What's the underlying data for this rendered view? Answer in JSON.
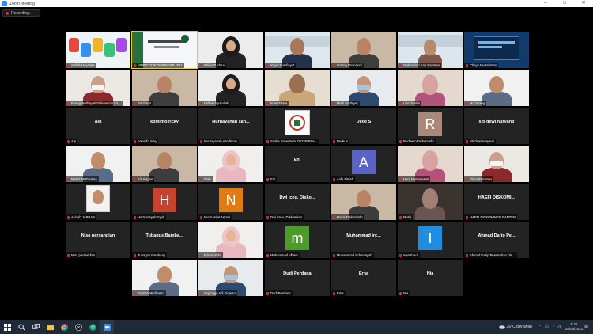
{
  "window": {
    "title": "Zoom Meeting",
    "controls": [
      "–",
      "□",
      "✕"
    ]
  },
  "recording": {
    "label": "Recording..."
  },
  "participants": [
    {
      "name": "Sofiah Hayatipa",
      "kind": "video",
      "scene": "letters"
    },
    {
      "name": "VIDEO DISKOMINFOSP 2021",
      "kind": "video",
      "scene": "banner",
      "active": true
    },
    {
      "name": "Erlina Zuchea",
      "kind": "video",
      "scene": "hijab-dark"
    },
    {
      "name": "Yayat Rusdiayat",
      "kind": "video",
      "scene": "man-building"
    },
    {
      "name": "Imtong Rusnandi",
      "kind": "video",
      "scene": "man-room"
    },
    {
      "name": "Diskominfo Kab.Bayaraa",
      "kind": "video",
      "scene": "building-lady"
    },
    {
      "name": "Cheyz Nurrahman",
      "kind": "video",
      "scene": "screen"
    },
    {
      "name": "Eneng Nurhayati Diskominfo Ka...",
      "kind": "video",
      "scene": "mask-red"
    },
    {
      "name": "Rachmat",
      "kind": "video",
      "scene": "man-room"
    },
    {
      "name": "Didi Hidayatullah",
      "kind": "video",
      "scene": "hijab-dark"
    },
    {
      "name": "Irvan Fitara",
      "kind": "video",
      "scene": "man-office"
    },
    {
      "name": "Marli Subhiyat",
      "kind": "video",
      "scene": "mask-blue"
    },
    {
      "name": "Lilis Danilis",
      "kind": "video",
      "scene": "lady-light"
    },
    {
      "name": "M Cacang",
      "kind": "video",
      "scene": "man-white"
    },
    {
      "name": "Aip",
      "kind": "name",
      "display": "Aip"
    },
    {
      "name": "kominfo ricky",
      "kind": "name",
      "display": "kominfo ricky"
    },
    {
      "name": "Nurhayanah sandiman",
      "kind": "name",
      "display": "Nurhayanah san..."
    },
    {
      "name": "Suska Sekertariat DKISP Prov...",
      "kind": "video",
      "scene": "logo"
    },
    {
      "name": "Dede S",
      "kind": "name",
      "display": "Dede S"
    },
    {
      "name": "Rudianto Diskominfo",
      "kind": "initial",
      "display": "R",
      "color": "#a9887a"
    },
    {
      "name": "siti dewi nuryanti",
      "kind": "name",
      "display": "siti dewi nuryanti"
    },
    {
      "name": "NANA NUGYANA",
      "kind": "video",
      "scene": "man-white"
    },
    {
      "name": "Ale Bagas",
      "kind": "video",
      "scene": "man-room"
    },
    {
      "name": "Diah",
      "kind": "video",
      "scene": "hijab-pink"
    },
    {
      "name": "Eni",
      "kind": "name",
      "display": "Eni"
    },
    {
      "name": "Aida Fitriah",
      "kind": "initial",
      "display": "A",
      "color": "#5a64c8"
    },
    {
      "name": "Heni Nurmalasari",
      "kind": "video",
      "scene": "lady-light"
    },
    {
      "name": "Dimo Pramono",
      "kind": "video",
      "scene": "mask-red"
    },
    {
      "name": "Azizah JABBAR",
      "kind": "video",
      "scene": "lady-photo"
    },
    {
      "name": "Harmansyah Syah",
      "kind": "initial",
      "display": "H",
      "color": "#c8432c"
    },
    {
      "name": "Nurmasitat Aryani",
      "kind": "initial",
      "display": "N",
      "color": "#e47b12"
    },
    {
      "name": "Dwi rizeu, Diskominfo",
      "kind": "name",
      "display": "Dwi Iceu, Disko..."
    },
    {
      "name": "Rosia Diskominfo",
      "kind": "video",
      "scene": "man-room"
    },
    {
      "name": "Mutia",
      "kind": "video",
      "scene": "lady-dark"
    },
    {
      "name": "HAEFI DISKOMINFO BANTEN",
      "kind": "name",
      "display": "HAEFI DISKOMI..."
    },
    {
      "name": "Nisa persandian",
      "kind": "name",
      "display": "Nisa persandian"
    },
    {
      "name": "Tubagus Bambang",
      "kind": "name",
      "display": "Tubagus Bamba..."
    },
    {
      "name": "Fricka Vidia",
      "kind": "video",
      "scene": "hijab-pink"
    },
    {
      "name": "Muhammad idham",
      "kind": "initial",
      "display": "m",
      "color": "#4c9a2a"
    },
    {
      "name": "Muhammad irchemsyah",
      "kind": "name",
      "display": "Muhammad irc..."
    },
    {
      "name": "Ivan Fauzi",
      "kind": "initial",
      "display": "I",
      "color": "#1f8ee0"
    },
    {
      "name": "Ahmad Darip Persandian Dis...",
      "kind": "name",
      "display": "Ahmad Darip Pe..."
    },
    {
      "name": "Septian Widiyanto",
      "kind": "video",
      "scene": "man-white"
    },
    {
      "name": "Sujanggy Adi Kirgeso",
      "kind": "video",
      "scene": "mask-blue"
    },
    {
      "name": "Dudi Perdana",
      "kind": "name",
      "display": "Dudi Perdana"
    },
    {
      "name": "Ema",
      "kind": "name",
      "display": "Erna"
    },
    {
      "name": "Nia",
      "kind": "name",
      "display": "Nia"
    }
  ],
  "taskbar": {
    "apps": [
      "windows-icon",
      "search-icon",
      "task-view-icon",
      "explorer-icon",
      "chrome-icon",
      "app-icon",
      "chrome-alt-icon",
      "zoom-icon"
    ],
    "weather": "26°C  Berawan",
    "time": "8:26",
    "date": "16/08/2021"
  }
}
